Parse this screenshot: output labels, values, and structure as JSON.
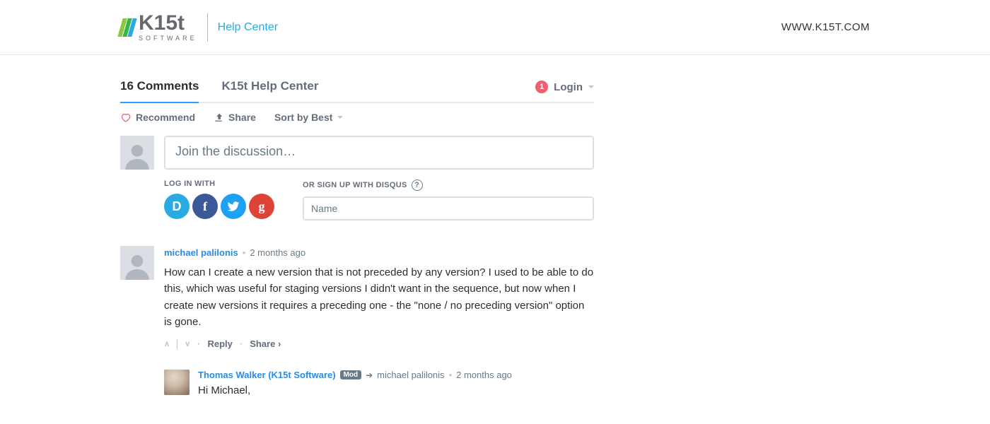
{
  "header": {
    "logo_main": "K15t",
    "logo_sub": "SOFTWARE",
    "help_center": "Help Center",
    "site_link": "WWW.K15T.COM"
  },
  "tabs": {
    "count_label": "16 Comments",
    "site_label": "K15t Help Center",
    "login_badge": "1",
    "login_label": "Login"
  },
  "toolbar": {
    "recommend": "Recommend",
    "share": "Share",
    "sort": "Sort by Best"
  },
  "compose": {
    "placeholder": "Join the discussion…"
  },
  "auth": {
    "login_label": "LOG IN WITH",
    "signup_label": "OR SIGN UP WITH DISQUS",
    "help_glyph": "?",
    "name_placeholder": "Name",
    "social": {
      "d": "D",
      "f": "f",
      "t": "t",
      "g": "g"
    }
  },
  "comment1": {
    "author": "michael palilonis",
    "ago": "2 months ago",
    "text": "How can I create a new version that is not preceded by any version? I used to be able to do this, which was useful for staging versions I didn't want in the sequence, but now when I create new versions it requires a preceding one - the \"none / no preceding version\" option is gone.",
    "reply_label": "Reply",
    "share_label": "Share ›"
  },
  "reply1": {
    "author": "Thomas Walker (K15t Software)",
    "mod": "Mod",
    "reply_to": "michael palilonis",
    "ago": "2 months ago",
    "text": "Hi Michael,"
  }
}
